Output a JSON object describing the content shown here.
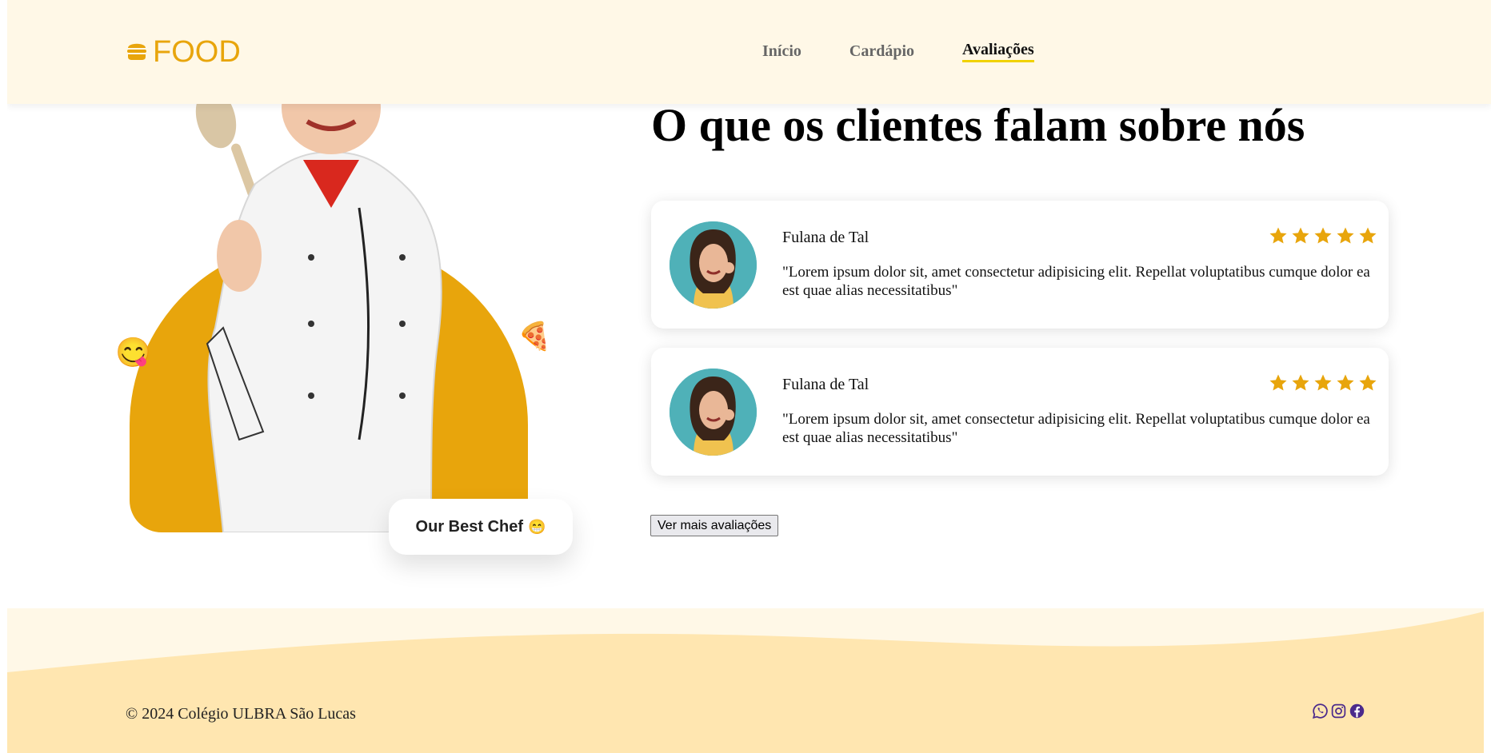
{
  "brand": {
    "name": "FOOD",
    "icon": "burger-icon",
    "color": "#e8a50c"
  },
  "nav": {
    "items": [
      {
        "label": "Início"
      },
      {
        "label": "Cardápio"
      },
      {
        "label": "Avaliações"
      }
    ],
    "active": "Avaliações",
    "active_underline_color": "#f1d200"
  },
  "hero": {
    "badge_label": "Our Best Chef",
    "badge_emoji": "😁",
    "emoji_left": "😋",
    "emoji_right": "🍕",
    "accent_color": "#e8a50c"
  },
  "reviews": {
    "title": "O que os clientes falam sobre nós",
    "items": [
      {
        "name": "Fulana de Tal",
        "text": "\"Lorem ipsum dolor sit, amet consectetur adipisicing elit. Repellat voluptatibus cumque dolor ea est quae alias necessitatibus\"",
        "rating": 5
      },
      {
        "name": "Fulana de Tal",
        "text": "\"Lorem ipsum dolor sit, amet consectetur adipisicing elit. Repellat voluptatibus cumque dolor ea est quae alias necessitatibus\"",
        "rating": 5
      }
    ],
    "more_label": "Ver mais avaliações",
    "star_color": "#e8a50c"
  },
  "footer": {
    "copyright": "© 2024 Colégio ULBRA São Lucas",
    "social_icons": [
      "whatsapp-icon",
      "instagram-icon",
      "facebook-icon"
    ],
    "icon_color": "#4b2a8c"
  }
}
